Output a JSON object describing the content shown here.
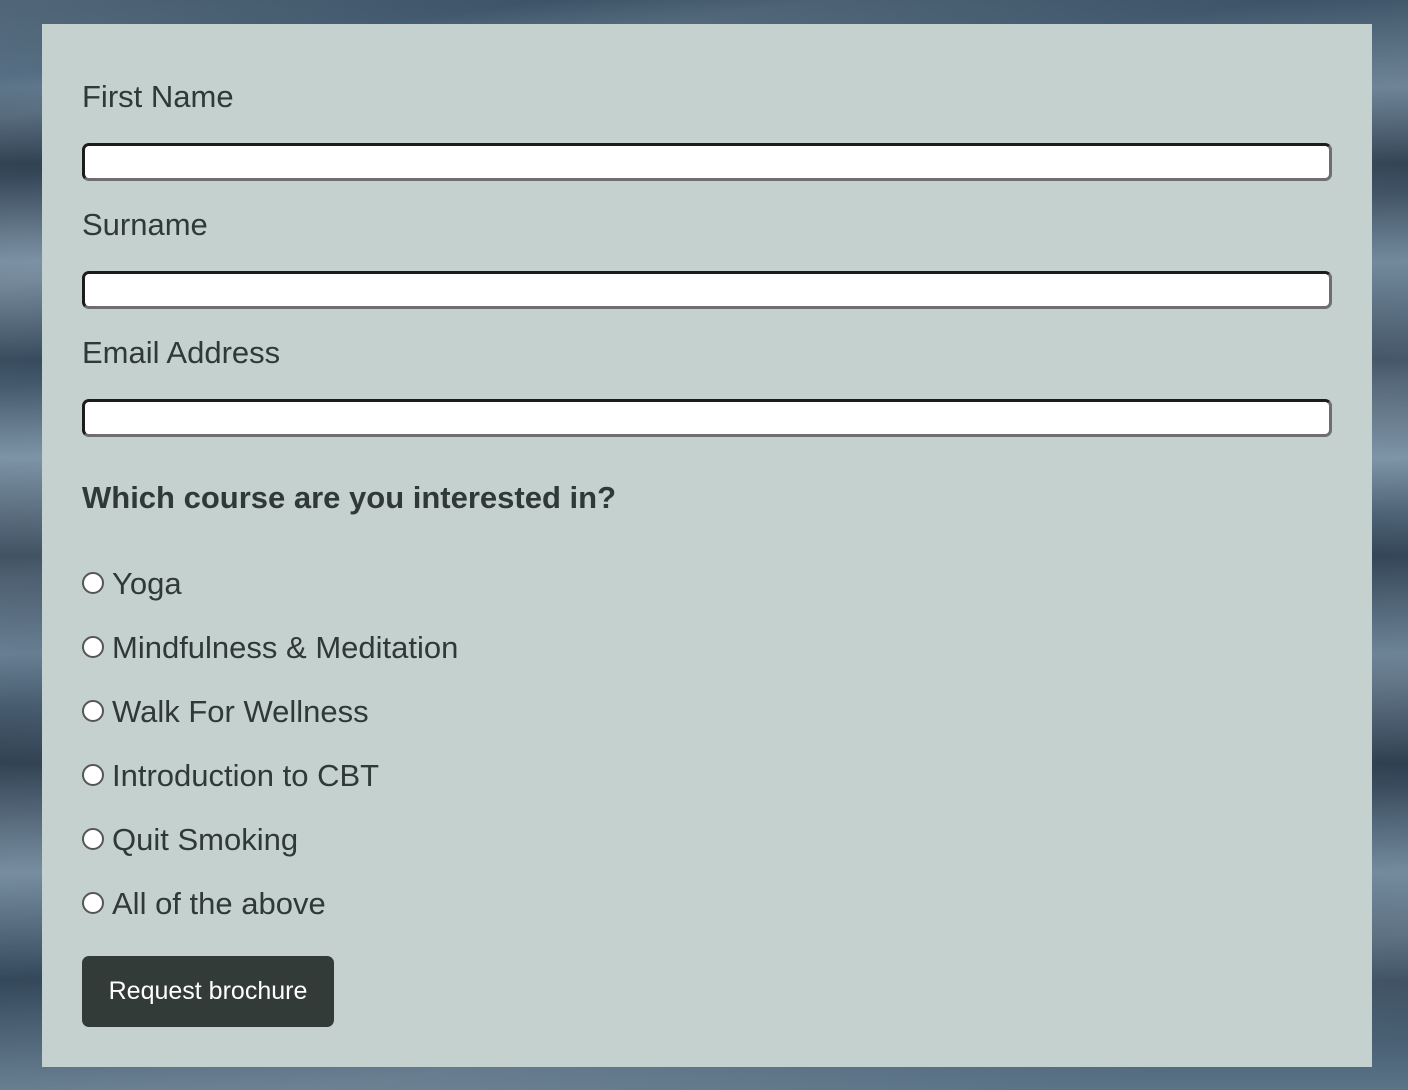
{
  "form": {
    "fields": [
      {
        "label": "First Name",
        "value": "",
        "placeholder": ""
      },
      {
        "label": "Surname",
        "value": "",
        "placeholder": ""
      },
      {
        "label": "Email Address",
        "value": "",
        "placeholder": ""
      }
    ],
    "question": "Which course are you interested in?",
    "options": [
      {
        "label": "Yoga",
        "selected": false
      },
      {
        "label": "Mindfulness & Meditation",
        "selected": false
      },
      {
        "label": "Walk For Wellness",
        "selected": false
      },
      {
        "label": "Introduction to CBT",
        "selected": false
      },
      {
        "label": "Quit Smoking",
        "selected": false
      },
      {
        "label": "All of the above",
        "selected": false
      }
    ],
    "submit_label": "Request brochure"
  },
  "colors": {
    "panel_background": "#c5d1cf",
    "text": "#2f3a36",
    "button_background": "#323b38",
    "button_text": "#ffffff"
  }
}
